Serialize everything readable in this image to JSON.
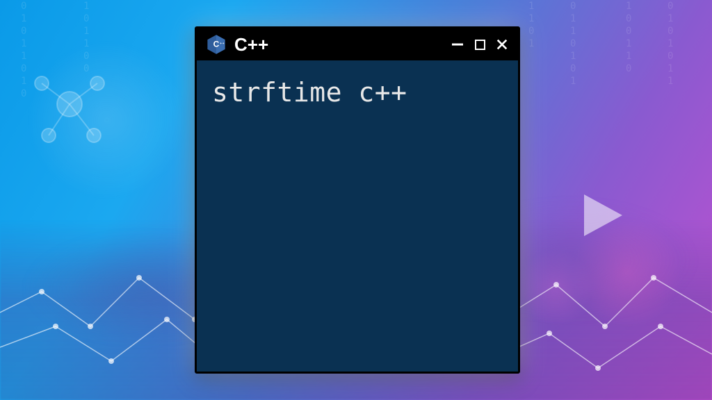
{
  "window": {
    "title": "C++",
    "icon_name": "cpp-hexagon-logo",
    "controls": {
      "minimize_label": "−",
      "maximize_label": "",
      "close_label": "×"
    }
  },
  "terminal": {
    "content": "strftime c++"
  },
  "colors": {
    "terminal_bg": "#0a3152",
    "titlebar_bg": "#000000",
    "text": "#e8e8e8"
  }
}
